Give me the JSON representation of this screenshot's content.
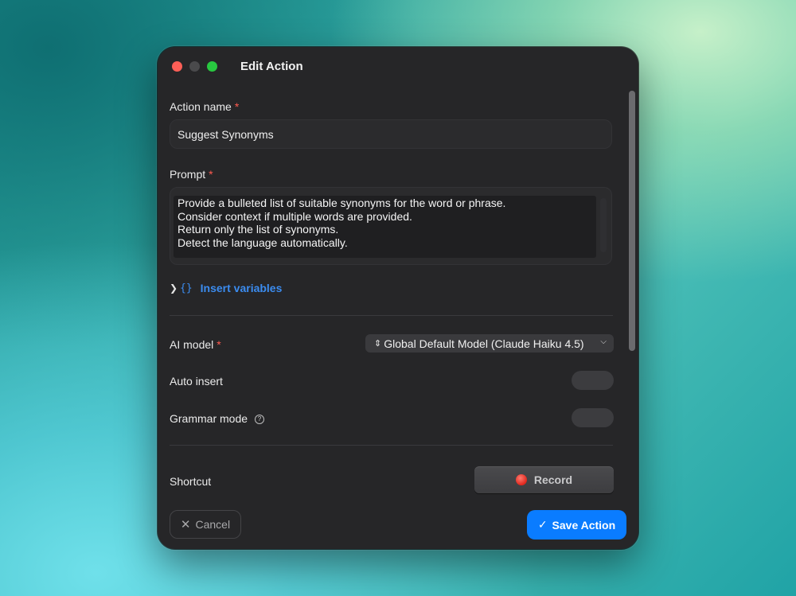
{
  "window": {
    "title": "Edit Action"
  },
  "fields": {
    "action_name": {
      "label": "Action name",
      "required_mark": "*",
      "value": "Suggest Synonyms"
    },
    "prompt": {
      "label": "Prompt",
      "required_mark": "*",
      "lines": [
        "Provide a bulleted list of suitable synonyms for the word or phrase.",
        "Consider context if multiple words are provided.",
        "Return only the list of synonyms.",
        "Detect the language automatically."
      ]
    },
    "insert_variables": {
      "label": "Insert variables",
      "icon": "{}"
    }
  },
  "settings": {
    "ai_model": {
      "label": "AI model",
      "required_mark": "*",
      "value": "Global Default Model (Claude Haiku 4.5)"
    },
    "auto_insert": {
      "label": "Auto insert",
      "enabled": false
    },
    "grammar_mode": {
      "label": "Grammar mode",
      "enabled": false,
      "help_icon": "question-circle-icon"
    },
    "shortcut": {
      "label": "Shortcut",
      "button_label": "Record"
    }
  },
  "footer": {
    "cancel_label": "Cancel",
    "save_label": "Save Action"
  },
  "colors": {
    "accent": "#0a7cff",
    "link": "#3b8cf0",
    "required": "#ff5a4f",
    "record_dot": "#e0261c"
  }
}
